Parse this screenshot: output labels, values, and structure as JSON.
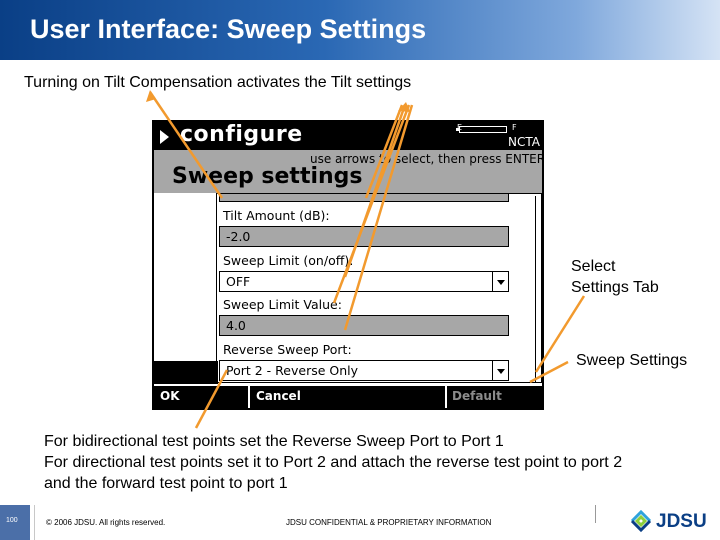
{
  "header": {
    "title": "User Interface:  Sweep Settings"
  },
  "subtitle": "Turning on Tilt Compensation activates the Tilt settings",
  "device": {
    "title": "configure",
    "status": "NCTA",
    "battery": {
      "empty_label": "E",
      "full_label": "F"
    },
    "instruction": "use arrows to select, then press ENTER.",
    "section_title": "Sweep settings",
    "fields": [
      {
        "label": "Tilt Amount (dB):",
        "value": "-2.0"
      },
      {
        "label": "Sweep Limit (on/off):",
        "value": "OFF"
      },
      {
        "label": "Sweep Limit Value:",
        "value": "4.0"
      },
      {
        "label": "Reverse Sweep Port:",
        "value": "Port 2 - Reverse Only"
      }
    ],
    "softkeys": {
      "ok": "OK",
      "cancel": "Cancel",
      "default": "Default"
    }
  },
  "annotations": {
    "select_settings_tab": "Select\nSettings Tab",
    "sweep_settings": "Sweep Settings"
  },
  "notes": [
    "For bidirectional test points set the Reverse Sweep Port to Port 1",
    "For directional test points set it to Port 2 and attach the reverse test point to port 2",
    "and the forward test point to port 1"
  ],
  "footer": {
    "page_number": "100",
    "copyright": "© 2006 JDSU. All rights reserved.",
    "confidential": "JDSU CONFIDENTIAL & PROPRIETARY INFORMATION",
    "logo_text": "JDSU"
  },
  "colors": {
    "header_start": "#0a3f86",
    "arrow": "#f29a2e",
    "device_grey": "#a7a7a7",
    "logo_blue": "#0b3f85"
  }
}
